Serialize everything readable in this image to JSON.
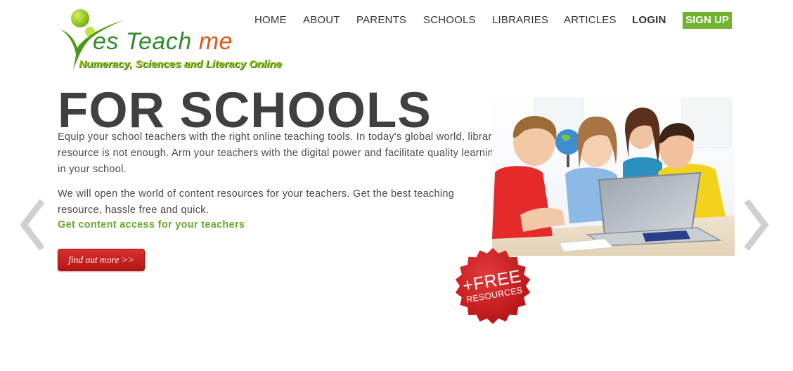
{
  "logo": {
    "word_prefix": "es Teach ",
    "word_suffix": "me",
    "tagline": "Numeracy, Sciences and Literacy Online"
  },
  "nav": {
    "items": [
      "HOME",
      "ABOUT",
      "PARENTS",
      "SCHOOLS",
      "LIBRARIES",
      "ARTICLES"
    ],
    "login": "LOGIN",
    "signup": "SIGN UP"
  },
  "hero": {
    "title": "FOR SCHOOLS",
    "paragraph1": "Equip your school teachers with the right online teaching tools. In today's global world, library resource is not enough. Arm your teachers with the digital power and facilitate quality learning in your school.",
    "paragraph2": "We will open the world of content resources for your teachers. Get the best teaching resource, hassle free and quick.",
    "link": "Get content access for your teachers",
    "button": "find out more >>"
  },
  "badge": {
    "line1": "+FREE",
    "line2": "RESOURCES"
  },
  "colors": {
    "accent_green": "#6fb32f",
    "button_red": "#c41e1e",
    "title_gray": "#404040"
  },
  "icons": {
    "prev": "chevron-left-icon",
    "next": "chevron-right-icon"
  }
}
